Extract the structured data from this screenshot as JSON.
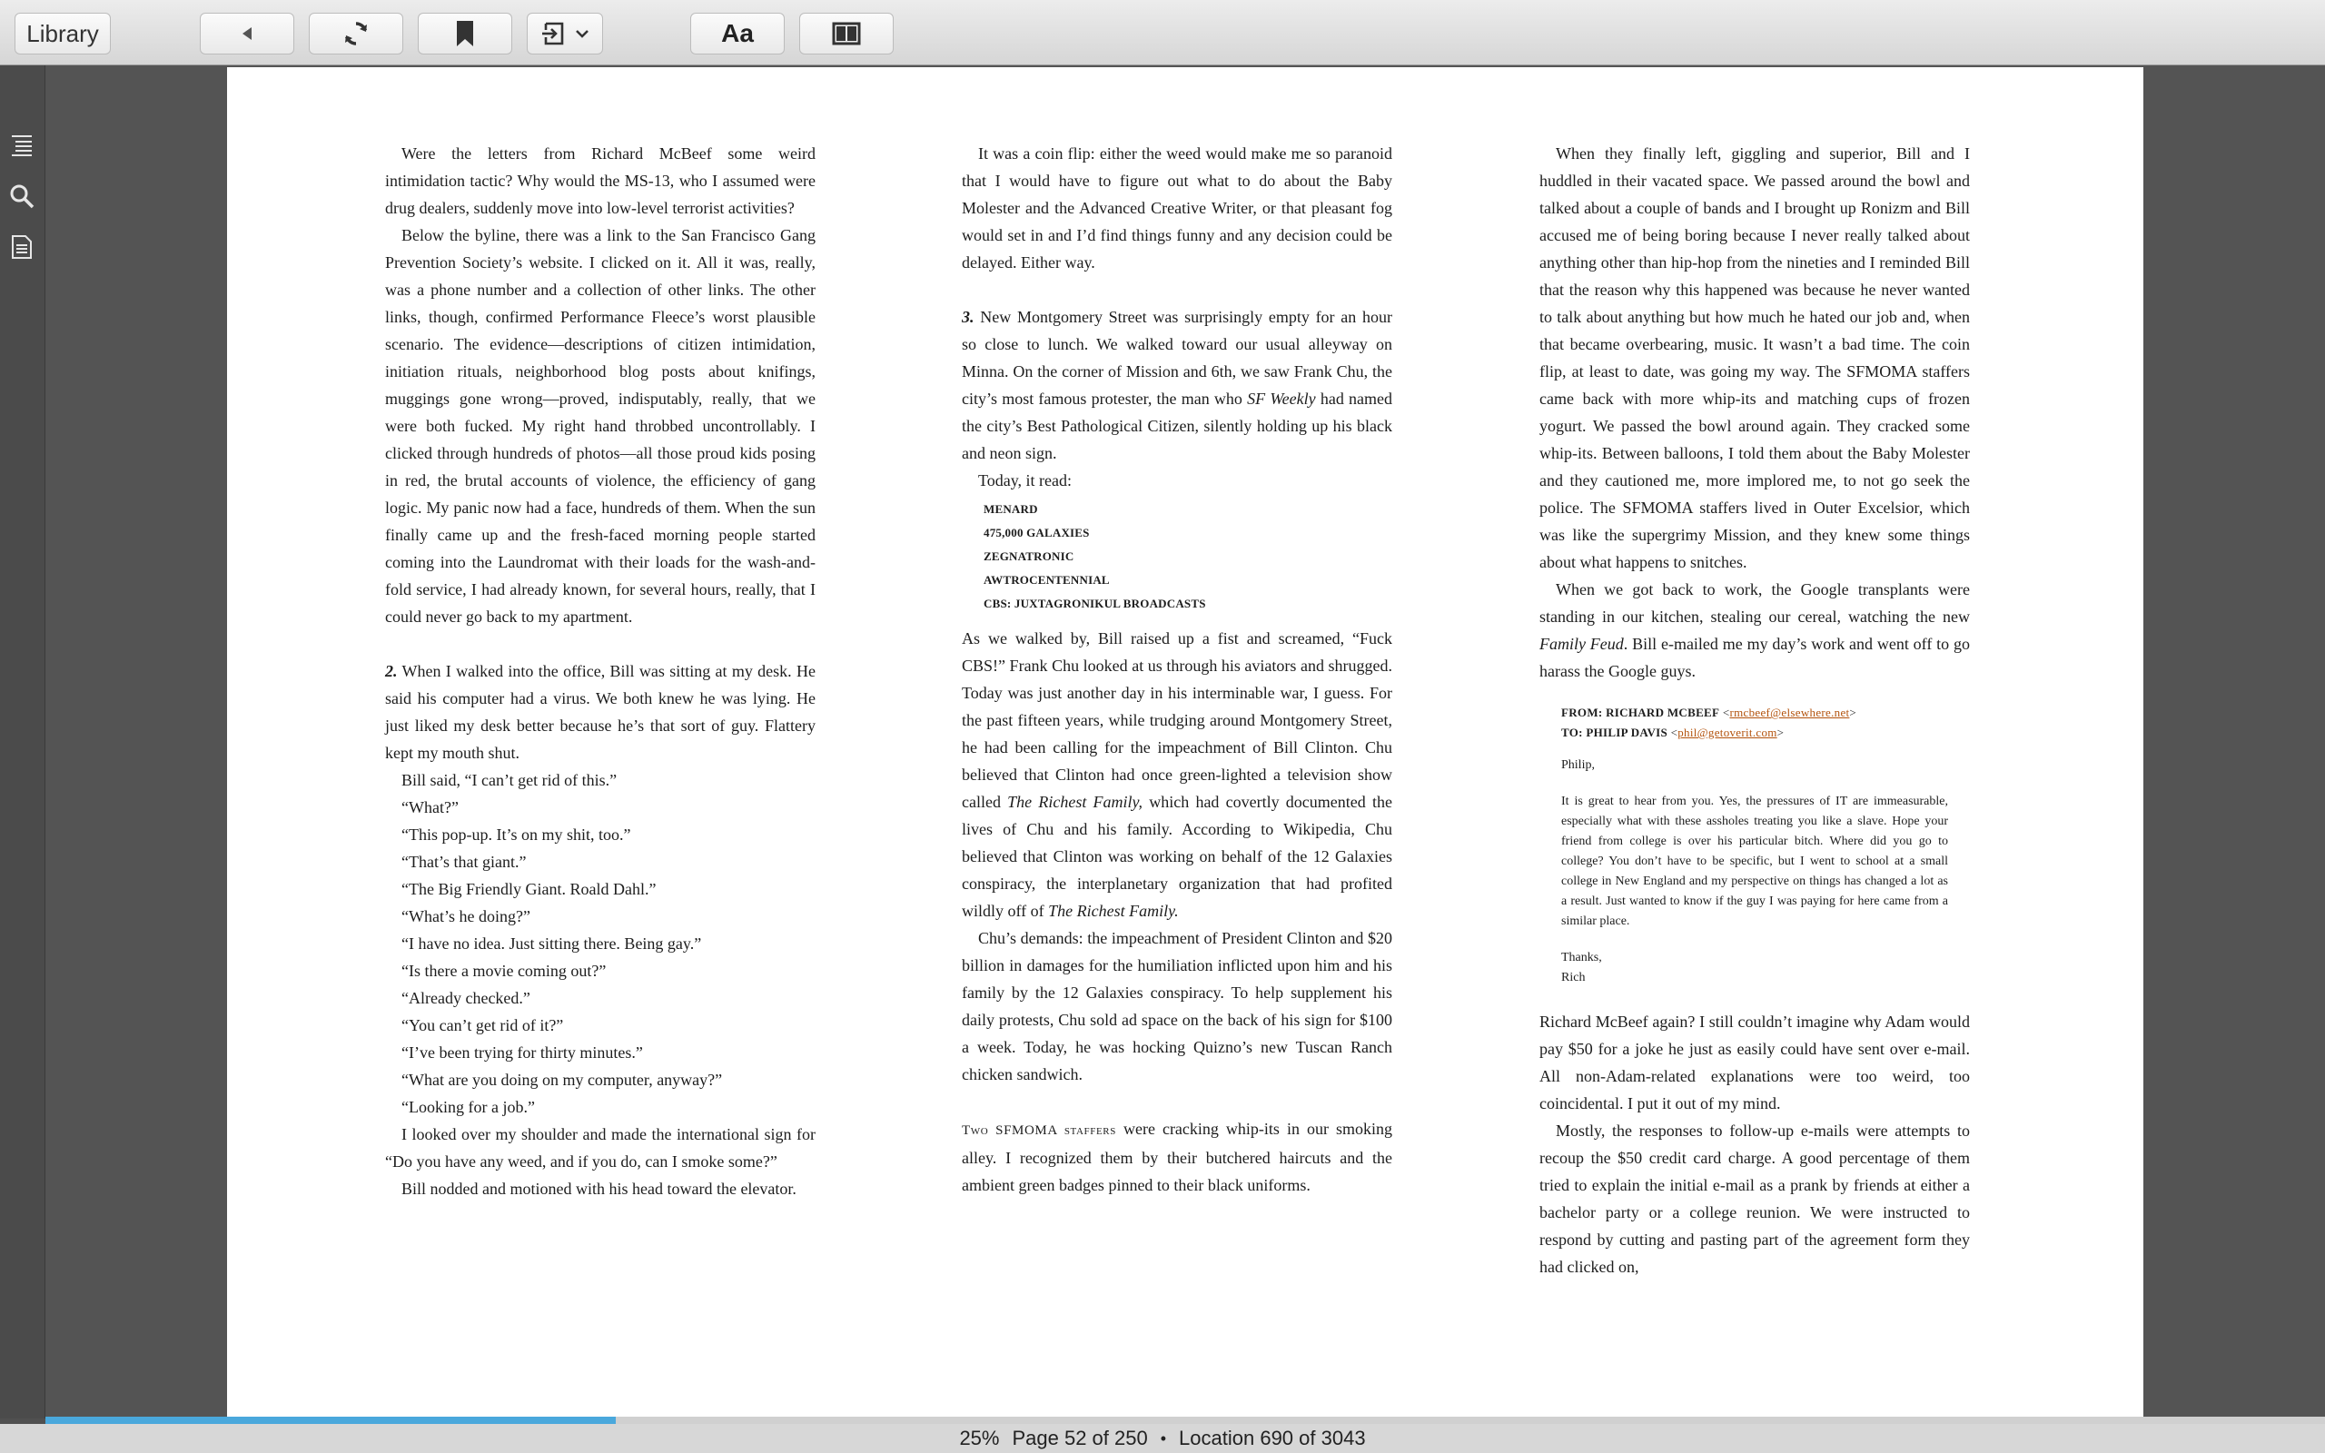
{
  "toolbar": {
    "library_label": "Library",
    "font_button_label": "Aa"
  },
  "status": {
    "percent": "25%",
    "page": "Page 52 of 250",
    "separator": "•",
    "location": "Location 690 of 3043",
    "progress_fraction": 0.25
  },
  "colors": {
    "progress": "#4aa8dc",
    "link": "#b3520c"
  },
  "col1": {
    "p1": "Were the letters from Richard McBeef some weird intimidation tactic? Why would the MS-13, who I assumed were drug dealers, suddenly move into low-level terrorist activities?",
    "p2": "Below the byline, there was a link to the San Francisco Gang Prevention Society’s website. I clicked on it. All it was, really, was a phone number and a collection of other links. The other links, though, confirmed Performance Fleece’s worst plausible scenario. The evidence—descriptions of citizen intimidation, initiation rituals, neighborhood blog posts about knifings, muggings gone wrong—proved, indisputably, really, that we were both fucked. My right hand throbbed uncontrollably. I clicked through hundreds of photos—all those proud kids posing in red, the brutal accounts of violence, the efficiency of gang logic. My panic now had a face, hundreds of them. When the sun finally came up and the fresh-faced morning people started coming into the Laundromat with their loads for the wash-and-fold service, I had already known, for several hours, really, that I could never go back to my apartment.",
    "p3_num": "2.",
    "p3": " When I walked into the office, Bill was sitting at my desk. He said his computer had a virus. We both knew he was lying. He just liked my desk better because he’s that sort of guy. Flattery kept my mouth shut.",
    "dialog": [
      "Bill said, “I can’t get rid of this.”",
      "“What?”",
      "“This pop-up. It’s on my shit, too.”",
      "“That’s that giant.”",
      "“The Big Friendly Giant. Roald Dahl.”",
      "“What’s he doing?”",
      "“I have no idea. Just sitting there. Being gay.”",
      "“Is there a movie coming out?”",
      "“Already checked.”",
      "“You can’t get rid of it?”",
      "“I’ve been trying for thirty minutes.”",
      "“What are you doing on my computer, anyway?”",
      "“Looking for a job.”"
    ],
    "p4": "I looked over my shoulder and made the international sign for “Do you have any weed, and if you do, can I smoke some?”",
    "p5": "Bill nodded and motioned with his head toward the elevator."
  },
  "col2": {
    "p1": "It was a coin flip: either the weed would make me so paranoid that I would have to figure out what to do about the Baby Molester and the Advanced Creative Writer, or that pleasant fog would set in and I’d find things funny and any decision could be delayed. Either way.",
    "p2_num": "3.",
    "p2a": " New Montgomery Street was surprisingly empty for an hour so close to lunch. We walked toward our usual alleyway on Minna. On the corner of Mission and 6th, we saw Frank Chu, the city’s most famous protester, the man who ",
    "p2_em": "SF Weekly",
    "p2b": " had named the city’s Best Pathological Citizen, silently holding up his black and neon sign.",
    "p3": "Today, it read:",
    "sign": [
      "MENARD",
      "475,000 GALAXIES",
      "ZEGNATRONIC",
      "AWTROCENTENNIAL",
      "CBS: JUXTAGRONIKUL BROADCASTS"
    ],
    "p4a": "As we walked by, Bill raised up a fist and screamed, “Fuck CBS!” Frank Chu looked at us through his aviators and shrugged. Today was just another day in his interminable war, I guess. For the past fifteen years, while trudging around Montgomery Street, he had been calling for the impeachment of Bill Clinton. Chu believed that Clinton had once green-lighted a television show called ",
    "p4_em1": "The Richest Family,",
    "p4b": " which had covertly documented the lives of Chu and his family. According to Wikipedia, Chu believed that Clinton was working on behalf of the 12 Galaxies conspiracy, the interplanetary organization that had profited wildly off of ",
    "p4_em2": "The Richest Family.",
    "p5": "Chu’s demands: the impeachment of President Clinton and $20 billion in damages for the humiliation inflicted upon him and his family by the 12 Galaxies conspiracy. To help supplement his daily protests, Chu sold ad space on the back of his sign for $100 a week. Today, he was hocking Quizno’s new Tuscan Ranch chicken sandwich.",
    "p6_sc": "Two SFMOMA staffers",
    "p6": " were cracking whip-its in our smoking alley. I recognized them by their butchered haircuts and the ambient green badges pinned to their black uniforms."
  },
  "col3": {
    "p1": "When they finally left, giggling and superior, Bill and I huddled in their vacated space. We passed around the bowl and talked about a couple of bands and I brought up Ronizm and Bill accused me of being boring because I never really talked about anything other than hip-hop from the nineties and I reminded Bill that the reason why this happened was because he never wanted to talk about anything but how much he hated our job and, when that became overbearing, music. It wasn’t a bad time. The coin flip, at least to date, was going my way. The SFMOMA staffers came back with more whip-its and matching cups of frozen yogurt. We passed the bowl around again. They cracked some whip-its. Between balloons, I told them about the Baby Molester and they cautioned me, more implored me, to not go seek the police. The SFMOMA staffers lived in Outer Excelsior, which was like the supergrimy Mission, and they knew some things about what happens to snitches.",
    "p2a": "When we got back to work, the Google transplants were standing in our kitchen, stealing our cereal, watching the new ",
    "p2_em": "Family Feud",
    "p2b": ". Bill e-mailed me my day’s work and went off to go harass the Google guys.",
    "email": {
      "from_label": "FROM: RICHARD MCBEEF",
      "from_addr": "rmcbeef@elsewhere.net",
      "to_label": "TO: PHILIP DAVIS",
      "to_addr": "phil@getoverit.com",
      "lt": "<",
      "gt": ">",
      "greeting": "Philip,",
      "body": "It is great to hear from you. Yes, the pressures of IT are immeasurable, especially what with these assholes treating you like a slave. Hope your friend from college is over his particular bitch. Where did you go to college? You don’t have to be specific, but I went to school at a small college in New England and my perspective on things has changed a lot as a result. Just wanted to know if the guy I was paying for here came from a similar place.",
      "signoff": "Thanks,",
      "name": "Rich"
    },
    "p3": "Richard McBeef again? I still couldn’t imagine why Adam would pay $50 for a joke he just as easily could have sent over e-mail. All non-Adam-related explanations were too weird, too coincidental. I put it out of my mind.",
    "p4": "Mostly, the responses to follow-up e-mails were attempts to recoup the $50 credit card charge. A good percentage of them tried to explain the initial e-mail as a prank by friends at either a bachelor party or a college reunion. We were instructed to respond by cutting and pasting part of the agreement form they had clicked on,"
  }
}
